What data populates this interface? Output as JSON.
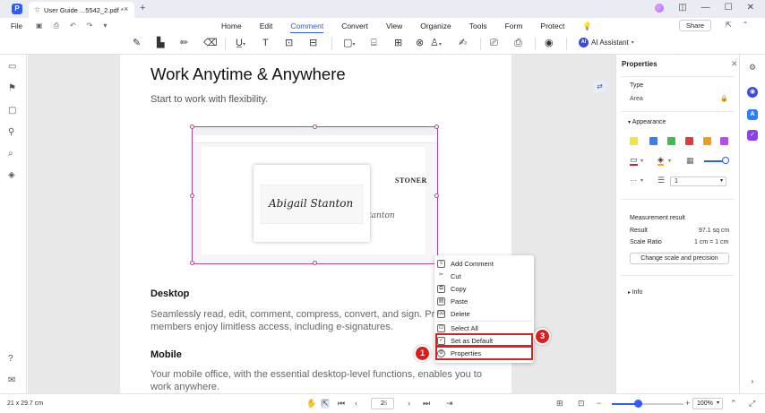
{
  "titlebar": {
    "tab_name": "User Guide ...5542_2.pdf *",
    "tab_close": "×",
    "new_tab": "+"
  },
  "menubar": {
    "file": "File",
    "tabs": [
      "Home",
      "Edit",
      "Comment",
      "Convert",
      "View",
      "Organize",
      "Tools",
      "Form",
      "Protect"
    ],
    "active_tab": "Comment",
    "share": "Share",
    "ai_assistant": "AI Assistant",
    "ai_badge": "AI"
  },
  "pdf": {
    "heading": "Work Anytime & Anywhere",
    "subheading": "Start to work with flexibility.",
    "desktop_heading": "Desktop",
    "desktop_text_1": "Seamlessly read, edit, comment, compress, convert, and sign. Pro",
    "desktop_text_2": "members enjoy limitless access, including e-signatures.",
    "mobile_heading": "Mobile",
    "mobile_text_1": "Your mobile office, with the essential desktop-level functions, enables you to",
    "mobile_text_2": "work anywhere.",
    "inner_screenshot": {
      "brand": "STONER",
      "signature_main": "Abigail Stanton",
      "signature_bg": "Abigail Stanton"
    }
  },
  "context_menu": {
    "items": [
      {
        "label": "Add Comment",
        "icon": "comment-icon"
      },
      {
        "label": "Cut",
        "icon": "scissors-icon"
      },
      {
        "label": "Copy",
        "icon": "copy-icon"
      },
      {
        "label": "Paste",
        "icon": "paste-icon"
      },
      {
        "label": "Delete",
        "icon": "trash-icon"
      },
      {
        "label": "Select All",
        "icon": "select-all-icon"
      },
      {
        "label": "Set as Default",
        "icon": "checkbox-icon"
      },
      {
        "label": "Properties",
        "icon": "properties-icon"
      }
    ]
  },
  "callouts": [
    "1",
    "2",
    "3"
  ],
  "properties": {
    "title": "Properties",
    "type_label": "Type",
    "type_value": "Area",
    "appearance_label": "Appearance",
    "swatches": [
      "#f5e33b",
      "#3b7cf5",
      "#3fbf4a",
      "#e03c3c",
      "#f59a1f",
      "#b34df0"
    ],
    "stroke_width": "1",
    "measurement_label": "Measurement result",
    "result_label": "Result",
    "result_value": "97.1 sq cm",
    "scale_label": "Scale Ratio",
    "scale_value": "1 cm = 1 cm",
    "change_scale_button": "Change scale and precision",
    "info_label": "Info"
  },
  "statusbar": {
    "page_size": "21 x 29.7 cm",
    "current_page": "2",
    "total_pages": "/5",
    "zoom": "100%"
  },
  "colors": {
    "accent": "#2d5bff",
    "callout_red": "#d72222",
    "selection_frame": "#b0488f"
  }
}
